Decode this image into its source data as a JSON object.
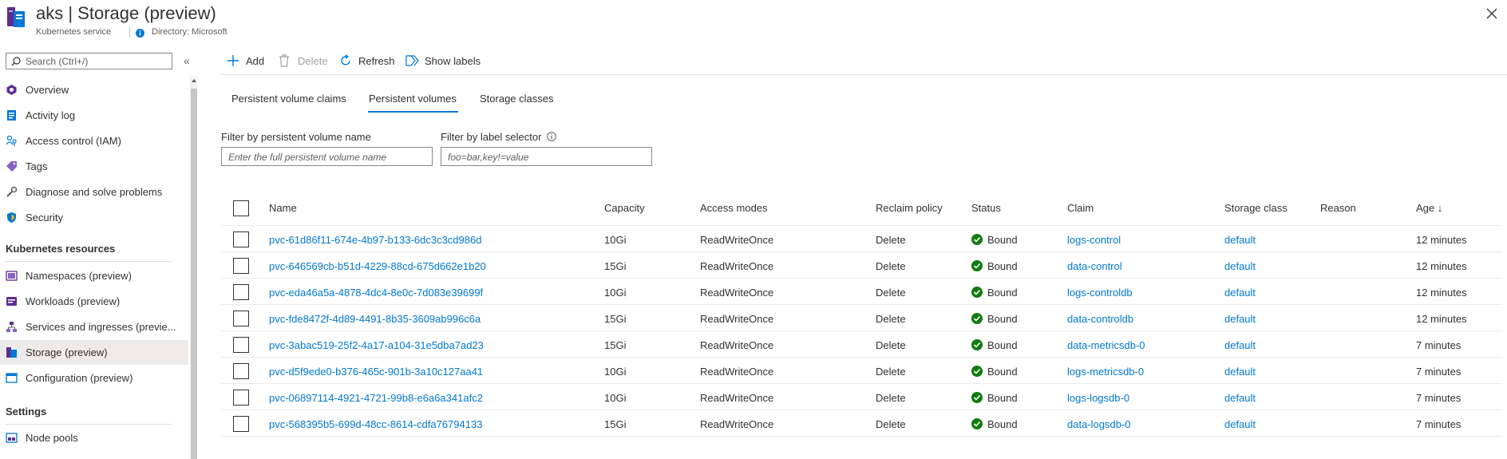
{
  "header": {
    "title": "aks | Storage (preview)",
    "subtitle": "Kubernetes service",
    "directory": "Directory: Microsoft"
  },
  "sidebar": {
    "search_placeholder": "Search (Ctrl+/)",
    "items": [
      {
        "label": "Overview",
        "icon": "overview-icon"
      },
      {
        "label": "Activity log",
        "icon": "activity-log-icon"
      },
      {
        "label": "Access control (IAM)",
        "icon": "access-control-icon"
      },
      {
        "label": "Tags",
        "icon": "tag-icon"
      },
      {
        "label": "Diagnose and solve problems",
        "icon": "wrench-icon"
      },
      {
        "label": "Security",
        "icon": "shield-icon"
      }
    ],
    "section_k8s": "Kubernetes resources",
    "k8s_items": [
      {
        "label": "Namespaces (preview)",
        "icon": "namespaces-icon"
      },
      {
        "label": "Workloads (preview)",
        "icon": "workloads-icon"
      },
      {
        "label": "Services and ingresses (previe...",
        "icon": "services-icon"
      },
      {
        "label": "Storage (preview)",
        "icon": "storage-icon",
        "selected": true
      },
      {
        "label": "Configuration (preview)",
        "icon": "configuration-icon"
      }
    ],
    "section_settings": "Settings",
    "settings_items": [
      {
        "label": "Node pools",
        "icon": "node-pools-icon"
      }
    ]
  },
  "toolbar": {
    "add": "Add",
    "delete": "Delete",
    "refresh": "Refresh",
    "show_labels": "Show labels"
  },
  "tabs": [
    "Persistent volume claims",
    "Persistent volumes",
    "Storage classes"
  ],
  "active_tab": "Persistent volumes",
  "filters": {
    "name_label": "Filter by persistent volume name",
    "name_placeholder": "Enter the full persistent volume name",
    "selector_label": "Filter by label selector",
    "selector_placeholder": "foo=bar,key!=value"
  },
  "table": {
    "headers": [
      "Name",
      "Capacity",
      "Access modes",
      "Reclaim policy",
      "Status",
      "Claim",
      "Storage class",
      "Reason",
      "Age ↓"
    ],
    "rows": [
      {
        "name": "pvc-61d86f11-674e-4b97-b133-6dc3c3cd986d",
        "capacity": "10Gi",
        "access": "ReadWriteOnce",
        "reclaim": "Delete",
        "status": "Bound",
        "claim": "logs-control",
        "class": "default",
        "reason": "",
        "age": "12 minutes"
      },
      {
        "name": "pvc-646569cb-b51d-4229-88cd-675d662e1b20",
        "capacity": "15Gi",
        "access": "ReadWriteOnce",
        "reclaim": "Delete",
        "status": "Bound",
        "claim": "data-control",
        "class": "default",
        "reason": "",
        "age": "12 minutes"
      },
      {
        "name": "pvc-eda46a5a-4878-4dc4-8e0c-7d083e39699f",
        "capacity": "10Gi",
        "access": "ReadWriteOnce",
        "reclaim": "Delete",
        "status": "Bound",
        "claim": "logs-controldb",
        "class": "default",
        "reason": "",
        "age": "12 minutes"
      },
      {
        "name": "pvc-fde8472f-4d89-4491-8b35-3609ab996c6a",
        "capacity": "15Gi",
        "access": "ReadWriteOnce",
        "reclaim": "Delete",
        "status": "Bound",
        "claim": "data-controldb",
        "class": "default",
        "reason": "",
        "age": "12 minutes"
      },
      {
        "name": "pvc-3abac519-25f2-4a17-a104-31e5dba7ad23",
        "capacity": "15Gi",
        "access": "ReadWriteOnce",
        "reclaim": "Delete",
        "status": "Bound",
        "claim": "data-metricsdb-0",
        "class": "default",
        "reason": "",
        "age": "7 minutes"
      },
      {
        "name": "pvc-d5f9ede0-b376-465c-901b-3a10c127aa41",
        "capacity": "10Gi",
        "access": "ReadWriteOnce",
        "reclaim": "Delete",
        "status": "Bound",
        "claim": "logs-metricsdb-0",
        "class": "default",
        "reason": "",
        "age": "7 minutes"
      },
      {
        "name": "pvc-06897114-4921-4721-99b8-e6a6a341afc2",
        "capacity": "10Gi",
        "access": "ReadWriteOnce",
        "reclaim": "Delete",
        "status": "Bound",
        "claim": "logs-logsdb-0",
        "class": "default",
        "reason": "",
        "age": "7 minutes"
      },
      {
        "name": "pvc-568395b5-699d-48cc-8614-cdfa76794133",
        "capacity": "15Gi",
        "access": "ReadWriteOnce",
        "reclaim": "Delete",
        "status": "Bound",
        "claim": "data-logsdb-0",
        "class": "default",
        "reason": "",
        "age": "7 minutes"
      }
    ]
  },
  "colors": {
    "accent": "#0078d4",
    "success": "#107c10",
    "text": "#323130"
  }
}
